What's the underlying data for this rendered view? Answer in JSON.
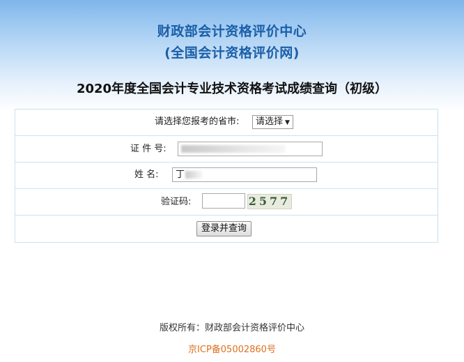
{
  "header": {
    "org_line1": "财政部会计资格评价中心",
    "org_line2": "(全国会计资格评价网)",
    "exam_title": "2020年度全国会计专业技术资格考试成绩查询（初级）"
  },
  "form": {
    "province_label": "请选择您报考的省市:",
    "province_selected": "请选择",
    "id_label": "证 件 号:",
    "name_label": "姓  名:",
    "name_value_visible": "丁",
    "captcha_label": "验证码:",
    "captcha_input_value": "",
    "captcha_text": "2577",
    "submit_label": "登录并查询"
  },
  "footer": {
    "copyright": "版权所有：财政部会计资格评价中心",
    "icp": "京ICP备05002860号"
  },
  "colors": {
    "org_title": "#1a5fa8",
    "border": "#c9e2ef",
    "icp_link": "#e0701e"
  }
}
